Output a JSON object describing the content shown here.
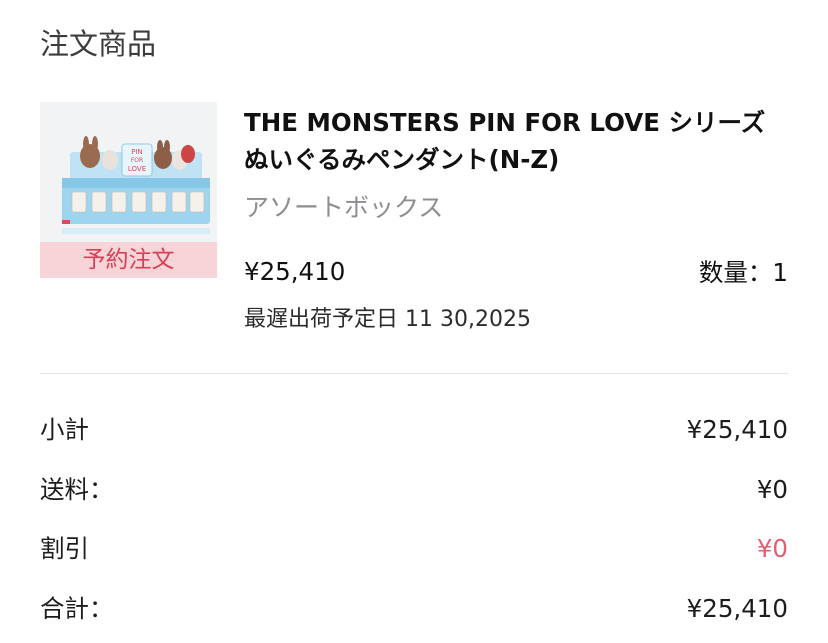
{
  "section": {
    "title": "注文商品"
  },
  "product": {
    "image_icon": "product-box-image",
    "badge": "予約注文",
    "name_line1": "THE MONSTERS PIN FOR LOVE シリーズ",
    "name_line2": "ぬいぐるみペンダント(N-Z)",
    "variant": "アソートボックス",
    "price": "¥25,410",
    "quantity": "数量：1",
    "ship_date": "最遅出荷予定日 11 30,2025"
  },
  "summary": {
    "subtotal_label": "小計",
    "subtotal_value": "¥25,410",
    "shipping_label": "送料：",
    "shipping_value": "¥0",
    "discount_label": "割引",
    "discount_value": "¥0",
    "total_label": "合計：",
    "total_value": "¥25,410"
  },
  "colors": {
    "badge_bg": "#f6d4d8",
    "badge_text": "#d94058",
    "discount": "#e0606f",
    "muted_text": "#8e8e92"
  }
}
